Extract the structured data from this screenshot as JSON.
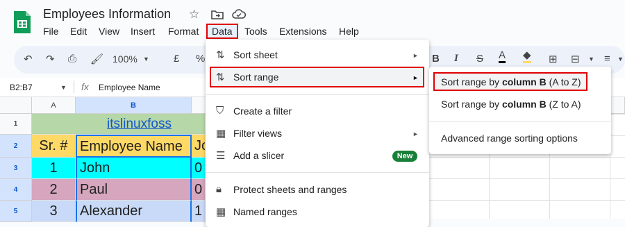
{
  "app": {
    "title": "Employees Information",
    "menu": [
      "File",
      "Edit",
      "View",
      "Insert",
      "Format",
      "Data",
      "Tools",
      "Extensions",
      "Help"
    ],
    "active_menu": "Data"
  },
  "toolbar": {
    "zoom": "100%",
    "currency": "£",
    "percent": "%"
  },
  "formula_bar": {
    "name_box": "B2:B7",
    "fx": "fx",
    "content": "Employee Name"
  },
  "grid": {
    "columns": [
      "A",
      "B"
    ],
    "rows": [
      "1",
      "2",
      "3",
      "4",
      "5"
    ],
    "title_link": "itslinuxfoss",
    "header": [
      "Sr. #",
      "Employee Name",
      "Jo"
    ],
    "data": [
      [
        "1",
        "John",
        "0"
      ],
      [
        "2",
        "Paul",
        "0"
      ],
      [
        "3",
        "Alexander",
        "1"
      ]
    ]
  },
  "data_menu": {
    "items": [
      {
        "label": "Sort sheet",
        "icon": "sort-icon",
        "arrow": "►"
      },
      {
        "label": "Sort range",
        "icon": "sort-icon",
        "arrow": "►"
      },
      {
        "label": "Create a filter",
        "icon": "filter-icon"
      },
      {
        "label": "Filter views",
        "icon": "table-icon",
        "arrow": "►"
      },
      {
        "label": "Add a slicer",
        "icon": "slicer-icon",
        "badge": "New"
      },
      {
        "label": "Protect sheets and ranges",
        "icon": "lock-icon"
      },
      {
        "label": "Named ranges",
        "icon": "table-icon"
      }
    ]
  },
  "sort_submenu": {
    "item1_prefix": "Sort range by ",
    "item1_bold": "column B",
    "item1_suffix": " (A to Z)",
    "item2_prefix": "Sort range by ",
    "item2_bold": "column B",
    "item2_suffix": " (Z to A)",
    "item3": "Advanced range sorting options"
  },
  "colors": {
    "highlight_red": "#e00000",
    "row1": "#b6d7a8",
    "row2": "#ffd966",
    "row3": "#00ffff",
    "row4": "#d5a6bd",
    "row5": "#c9daf8",
    "link": "#1155cc",
    "badge": "#188038"
  }
}
